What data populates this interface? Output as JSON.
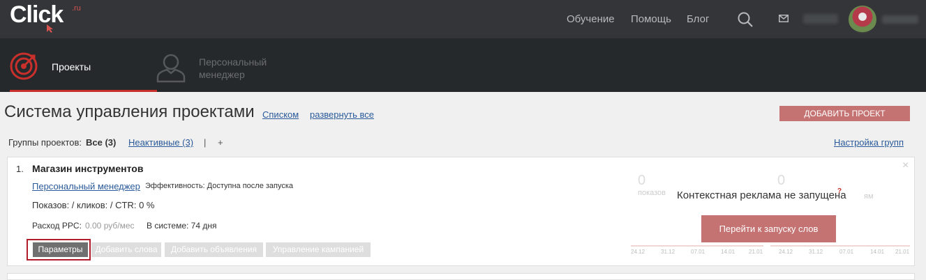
{
  "brand": {
    "logo_text": "Click",
    "logo_suffix": ".ru"
  },
  "topnav": {
    "learning": "Обучение",
    "help": "Помощь",
    "blog": "Блог"
  },
  "subnav": {
    "projects": "Проекты",
    "manager": "Персональный менеджер"
  },
  "page": {
    "title": "Система управления проектами",
    "list_link": "Списком",
    "expand_link": "развернуть все",
    "add_project": "ДОБАВИТЬ ПРОЕКТ"
  },
  "groups": {
    "label": "Группы проектов:",
    "all": "Все (3)",
    "inactive": "Неактивные (3)",
    "separator": "|",
    "add": "+",
    "settings": "Настройка групп"
  },
  "project": {
    "number": "1.",
    "name": "Магазин инструментов",
    "manager_link": "Персональный менеджер",
    "efficiency": "Эффективность: Доступна после запуска",
    "stats": "Показов: / кликов: / CTR: 0 %",
    "expense_label": "Расход PPC:",
    "expense_value": "0.00 руб/мес",
    "in_system": "В системе: 74 дня",
    "buttons": {
      "params": "Параметры",
      "add_words": "Добавить слова",
      "add_ads": "Добавить объявления",
      "manage": "Управление кампанией"
    },
    "close": "×",
    "impressions_value": "0",
    "impressions_caption": "показов",
    "clicks_value": "0",
    "clicks_caption_tail": "ям",
    "ad_status": "Контекстная реклама не запущена",
    "help_mark": "?",
    "launch_button": "Перейти к запуску слов",
    "chart_dates": [
      "24.12",
      "31.12",
      "07.01",
      "14.01",
      "21.01"
    ]
  },
  "colors": {
    "accent_red": "#c9302c",
    "button_muted_red": "#c47272",
    "topbar": "#333538",
    "subbar": "#26292c"
  }
}
